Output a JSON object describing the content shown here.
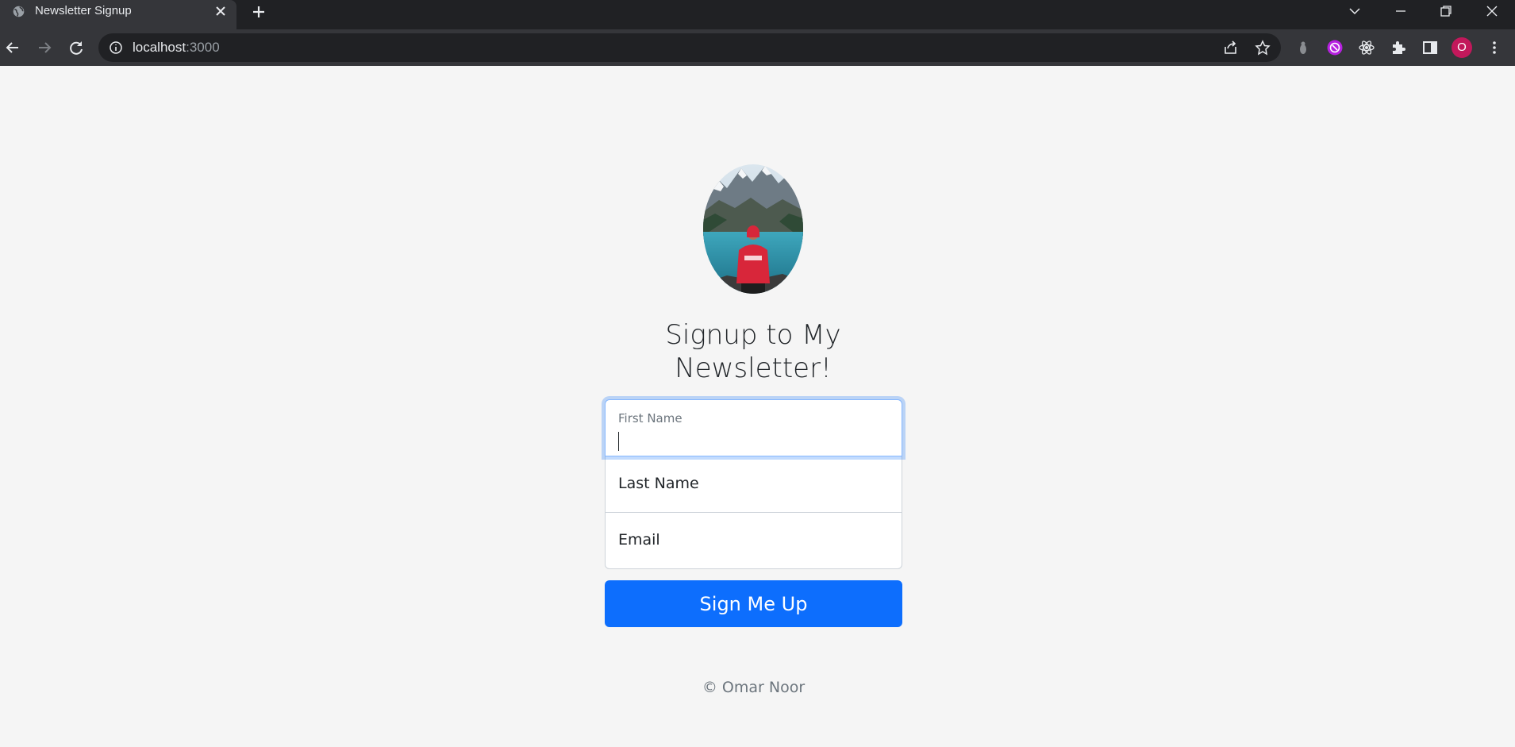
{
  "browser": {
    "tab_title": "Newsletter Signup",
    "url_host": "localhost",
    "url_port": ":3000",
    "profile_initial": "O"
  },
  "page": {
    "heading": "Signup to My Newsletter!",
    "form": {
      "first_name": {
        "label": "First Name",
        "value": ""
      },
      "last_name": {
        "placeholder": "Last Name"
      },
      "email": {
        "placeholder": "Email"
      },
      "submit_label": "Sign Me Up"
    },
    "footer": "© Omar Noor"
  },
  "colors": {
    "primary": "#0d6efd",
    "background": "#f5f5f5",
    "chrome_dark": "#202124",
    "chrome_toolbar": "#35363a",
    "avatar": "#c2185b"
  }
}
